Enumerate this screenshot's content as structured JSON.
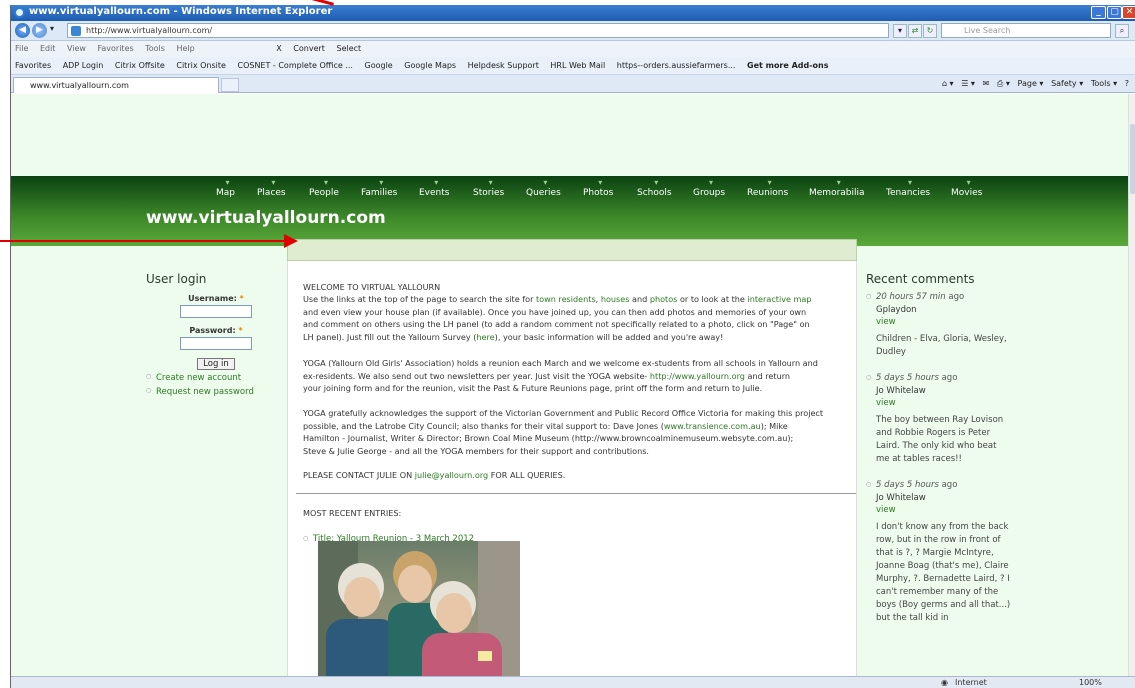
{
  "window": {
    "title": "www.virtualyallourn.com - Windows Internet Explorer",
    "min": "_",
    "max": "▢",
    "close": "✕"
  },
  "address": {
    "url": "http://www.virtualyallourn.com/",
    "search_placeholder": "Live Search"
  },
  "menu": [
    "File",
    "Edit",
    "View",
    "Favorites",
    "Tools",
    "Help"
  ],
  "menu_tools": {
    "close_x": "X",
    "convert": "Convert",
    "select": "Select"
  },
  "favorites": [
    "Favorites",
    "ADP Login",
    "Citrix Offsite",
    "Citrix Onsite",
    "COSNET - Complete Office ...",
    "Google",
    "Google Maps",
    "Helpdesk Support",
    "HRL Web Mail",
    "https--orders.aussiefarmers...",
    "Get more Add-ons"
  ],
  "tab": {
    "label": "www.virtualyallourn.com"
  },
  "command_bar": [
    "Page",
    "Safety",
    "Tools"
  ],
  "site": {
    "title": "www.virtualyallourn.com",
    "nav": [
      "Map",
      "Places",
      "People",
      "Families",
      "Events",
      "Stories",
      "Queries",
      "Photos",
      "Schools",
      "Groups",
      "Reunions",
      "Memorabilia",
      "Tenancies",
      "Movies"
    ]
  },
  "login": {
    "heading": "User login",
    "username_label": "Username:",
    "password_label": "Password:",
    "required": "*",
    "button": "Log in",
    "create_account": "Create new account",
    "request_password": "Request new password"
  },
  "main": {
    "welcome_heading": "WELCOME TO VIRTUAL YALLOURN",
    "p1_a": "Use the links at the top of the page to search the site for ",
    "p1_l1": "town residents",
    "p1_b": ", ",
    "p1_l2": "houses",
    "p1_c": " and ",
    "p1_l3": "photos",
    "p1_d": " or to look at the ",
    "p1_l4": "interactive map",
    "p1_line2": "and even view your house plan (if available). Once you have joined up, you can then add photos and memories of your own",
    "p1_line3": "and comment on others using the LH panel (to add a random comment not specifically related to a photo, click on \"Page\" on",
    "p1_line4a": "LH panel). Just fill out the Yallourn Survey (",
    "p1_line4_link": "here",
    "p1_line4b": "), your basic information will be added and you're away!",
    "p2_line1": "YOGA (Yallourn Old Girls' Association) holds a reunion each March and we welcome ex-students from all schools in Yallourn and",
    "p2_line2a": "ex-residents. We also send out two newsletters per year. Just visit the YOGA website- ",
    "p2_line2_link": "http://www.yallourn.org",
    "p2_line2b": " and return",
    "p2_line3": "your joining form and for the reunion, visit the Past & Future Reunions page, print off the form and return to Julie.",
    "p3_line1": "YOGA gratefully acknowledges the support of the Victorian Government and Public Record Office Victoria for making this project",
    "p3_line2a": "possible, and the Latrobe City Council; also thanks for their vital support to: Dave Jones (",
    "p3_line2_link": "www.transience.com.au",
    "p3_line2b": "); Mike",
    "p3_line3": "Hamilton - Journalist, Writer & Director; Brown Coal Mine Museum (http://www.browncoalminemuseum.websyte.com.au);",
    "p3_line4": "Steve & Julie George - and all the YOGA members for their support and contributions.",
    "contact_a": "PLEASE CONTACT JULIE ON ",
    "contact_link": "julie@yallourn.org",
    "contact_b": " FOR ALL QUERIES.",
    "recent_heading": "MOST RECENT ENTRIES:",
    "entry_title": "Title: Yallourn Reunion - 3 March 2012"
  },
  "comments": {
    "heading": "Recent comments",
    "items": [
      {
        "when": "20 hours 57 min",
        "ago": "ago",
        "user": "Gplaydon",
        "view": "view",
        "body": "Children - Elva, Gloria, Wesley, Dudley"
      },
      {
        "when": "5 days 5 hours",
        "ago": "ago",
        "user": "Jo Whitelaw",
        "view": "view",
        "body": "The boy between Ray Lovison and Robbie Rogers is Peter Laird. The only kid who beat me at tables races!!"
      },
      {
        "when": "5 days 5 hours",
        "ago": "ago",
        "user": "Jo Whitelaw",
        "view": "view",
        "body": "I don't know any from the back row, but in the row in front of that is ?, ? Margie McIntyre, Joanne Boag (that's me), Claire Murphy, ?. Bernadette Laird, ? I can't remember many of the boys (Boy germs and all that...) but the tall kid in"
      }
    ]
  },
  "status": {
    "zone": "Internet",
    "zoom": "100%"
  },
  "colors": {
    "annotation": "#e00000",
    "header_green": "#0b4212",
    "link_green": "#2c7a22"
  }
}
